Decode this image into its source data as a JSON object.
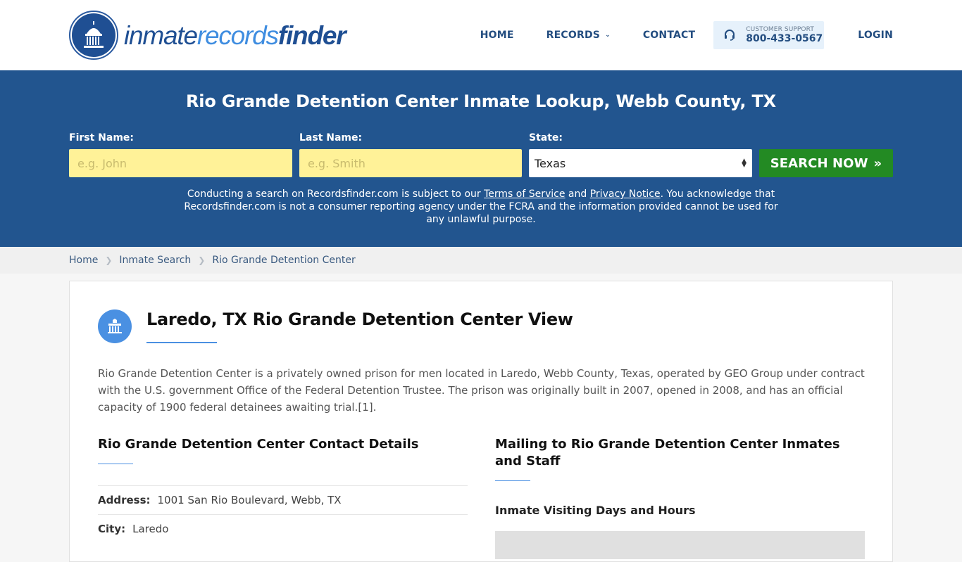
{
  "header": {
    "logo": {
      "part1": "inmate",
      "part2": "records",
      "part3": "finder"
    },
    "nav": {
      "home": "HOME",
      "records": "RECORDS",
      "contact": "CONTACT",
      "support_label": "CUSTOMER SUPPORT",
      "support_phone": "800-433-0567",
      "login": "LOGIN"
    }
  },
  "hero": {
    "title": "Rio Grande Detention Center Inmate Lookup, Webb County, TX",
    "first_name_label": "First Name:",
    "first_name_placeholder": "e.g. John",
    "first_name_value": "",
    "last_name_label": "Last Name:",
    "last_name_placeholder": "e.g. Smith",
    "last_name_value": "",
    "state_label": "State:",
    "state_value": "Texas",
    "search_button": "SEARCH NOW",
    "disclaimer_1": "Conducting a search on Recordsfinder.com is subject to our ",
    "terms_link": "Terms of Service",
    "disclaimer_and": " and ",
    "privacy_link": "Privacy Notice",
    "disclaimer_2": ". You acknowledge that Recordsfinder.com is not a consumer reporting agency under the FCRA and the information provided cannot be used for any unlawful purpose."
  },
  "breadcrumb": [
    {
      "label": "Home"
    },
    {
      "label": "Inmate Search"
    },
    {
      "label": "Rio Grande Detention Center"
    }
  ],
  "main": {
    "title": "Laredo, TX Rio Grande Detention Center View",
    "intro": "Rio Grande Detention Center is a privately owned prison for men located in Laredo, Webb County, Texas, operated by GEO Group under contract with the U.S. government Office of the Federal Detention Trustee. The prison was originally built in 2007, opened in 2008, and has an official capacity of 1900 federal detainees awaiting trial.[1].",
    "contact": {
      "title": "Rio Grande Detention Center Contact Details",
      "rows": [
        {
          "key": "Address:",
          "value": "1001 San Rio Boulevard, Webb, TX"
        },
        {
          "key": "City:",
          "value": "Laredo"
        }
      ]
    },
    "mailing": {
      "title": "Mailing to Rio Grande Detention Center Inmates and Staff",
      "visiting_title": "Inmate Visiting Days and Hours"
    }
  },
  "colors": {
    "brand_blue": "#22558f",
    "accent_blue": "#4a90e2",
    "search_green": "#238a23",
    "input_yellow": "#fff298"
  }
}
